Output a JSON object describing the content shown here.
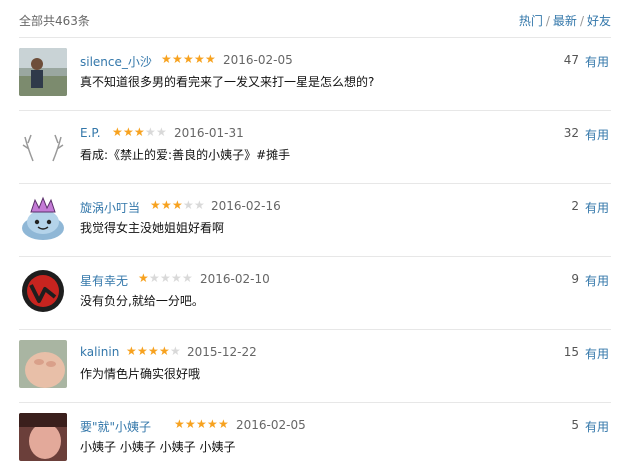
{
  "header": {
    "total": "全部共463条",
    "sort": {
      "hot": "热门",
      "latest": "最新",
      "friends": "好友",
      "separator": "/"
    }
  },
  "comments": [
    {
      "user": "silence_小沙",
      "rating": 5,
      "date": "2016-02-05",
      "text": "真不知道很多男的看完来了一发又来打一星是怎么想的?",
      "votes": "47",
      "useful": "有用"
    },
    {
      "user": "E.P.",
      "rating": 3,
      "date": "2016-01-31",
      "text": "看成:《禁止的爱:善良的小姨子》#摊手",
      "votes": "32",
      "useful": "有用"
    },
    {
      "user": "旋涡小叮当",
      "rating": 3,
      "date": "2016-02-16",
      "text": "我觉得女主没她姐姐好看啊",
      "votes": "2",
      "useful": "有用"
    },
    {
      "user": "星有幸无",
      "rating": 1,
      "date": "2016-02-10",
      "text": "没有负分,就给一分吧。",
      "votes": "9",
      "useful": "有用"
    },
    {
      "user": "kalinin",
      "rating": 4,
      "date": "2015-12-22",
      "text": "作为情色片确实很好哦",
      "votes": "15",
      "useful": "有用"
    },
    {
      "user": "要\"就\"小姨子",
      "rating": 5,
      "date": "2016-02-05",
      "text": "小姨子 小姨子 小姨子 小姨子",
      "votes": "5",
      "useful": "有用"
    }
  ],
  "colors": {
    "link": "#3377aa",
    "star_on": "#f7a21f",
    "star_off": "#d9d9d9",
    "divider": "#e7e7e7"
  },
  "icons": [
    "avatar-photo",
    "antlers-icon",
    "slime-king-icon",
    "red-circle-logo-icon",
    "avatar-photo",
    "avatar-photo"
  ]
}
